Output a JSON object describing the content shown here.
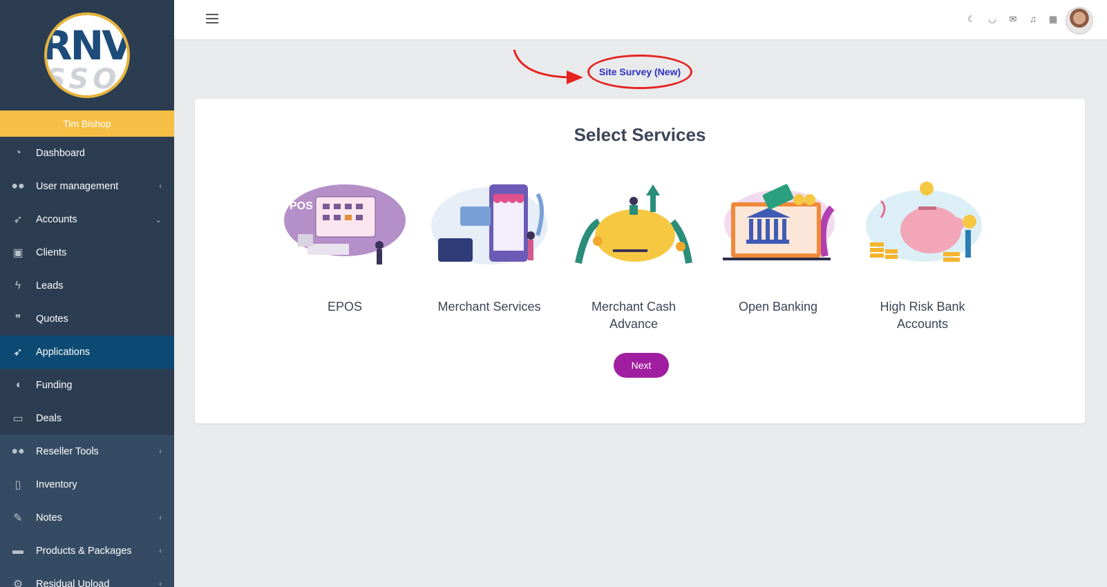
{
  "sidebar": {
    "user_name": "Tim Bishop",
    "items": [
      {
        "label": "Dashboard",
        "icon": "gauge-icon",
        "chevron": ""
      },
      {
        "label": "User management",
        "icon": "users-icon",
        "chevron": "‹"
      },
      {
        "label": "Accounts",
        "icon": "rocket-icon",
        "chevron": "⌄"
      },
      {
        "label": "Clients",
        "icon": "briefcase-icon",
        "chevron": ""
      },
      {
        "label": "Leads",
        "icon": "bolt-icon",
        "chevron": ""
      },
      {
        "label": "Quotes",
        "icon": "quote-icon",
        "chevron": ""
      },
      {
        "label": "Applications",
        "icon": "rocket-icon",
        "chevron": ""
      },
      {
        "label": "Funding",
        "icon": "piggy-bank-icon",
        "chevron": ""
      },
      {
        "label": "Deals",
        "icon": "money-icon",
        "chevron": ""
      },
      {
        "label": "Reseller Tools",
        "icon": "users-icon",
        "chevron": "‹"
      },
      {
        "label": "Inventory",
        "icon": "mobile-icon",
        "chevron": ""
      },
      {
        "label": "Notes",
        "icon": "edit-icon",
        "chevron": "‹"
      },
      {
        "label": "Products & Packages",
        "icon": "hdd-icon",
        "chevron": "‹"
      },
      {
        "label": "Residual Upload",
        "icon": "cogs-icon",
        "chevron": "‹"
      }
    ],
    "active_item": "Applications"
  },
  "header": {
    "icons": [
      "moon-icon",
      "headset-icon",
      "mail-icon",
      "bell-icon",
      "calendar-icon"
    ]
  },
  "annotation": {
    "link_label": "Site Survey (New)",
    "highlight_color": "#e52320"
  },
  "main": {
    "title": "Select Services",
    "services": [
      {
        "label": "EPOS"
      },
      {
        "label": "Merchant Services"
      },
      {
        "label": "Merchant Cash Advance"
      },
      {
        "label": "Open Banking"
      },
      {
        "label": "High Risk Bank Accounts"
      }
    ],
    "next_label": "Next"
  },
  "colors": {
    "sidebar_bg": "#2c3d52",
    "active_bg": "#0d4a73",
    "user_bar": "#f4bf44",
    "next_button": "#a01fa0"
  }
}
